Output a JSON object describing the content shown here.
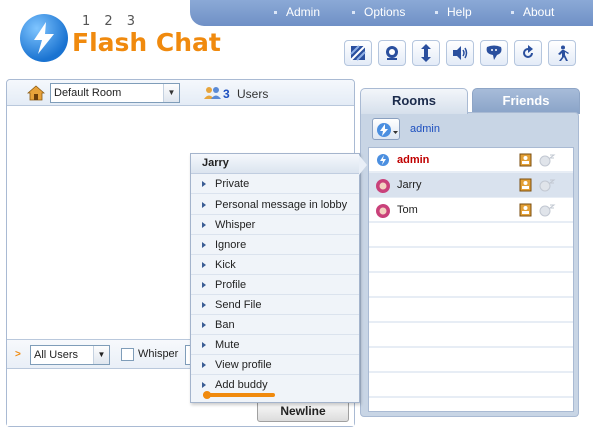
{
  "logo": {
    "number": "1 2 3",
    "title": "Flash Chat"
  },
  "nav": [
    {
      "label": "Admin"
    },
    {
      "label": "Options"
    },
    {
      "label": "Help"
    },
    {
      "label": "About"
    }
  ],
  "toolbar": {
    "icons": [
      "skin-icon",
      "avatar-icon",
      "font-size-icon",
      "sound-icon",
      "smileys-icon",
      "refresh-icon",
      "logout-icon"
    ]
  },
  "room": {
    "selected": "Default Room"
  },
  "users": {
    "count": "3",
    "label": "Users"
  },
  "input": {
    "recipient": "All Users",
    "whisper_label": "Whisper",
    "newline_label": "Newline"
  },
  "tabs": {
    "rooms": "Rooms",
    "friends": "Friends"
  },
  "me": {
    "name": "admin"
  },
  "user_list": [
    {
      "name": "admin",
      "role": "admin"
    },
    {
      "name": "Jarry",
      "role": "user"
    },
    {
      "name": "Tom",
      "role": "user"
    }
  ],
  "context_menu": {
    "title": "Jarry",
    "items": [
      "Private",
      "Personal message in lobby",
      "Whisper",
      "Ignore",
      "Kick",
      "Profile",
      "Send File",
      "Ban",
      "Mute",
      "View profile",
      "Add buddy"
    ]
  },
  "colors": {
    "accent": "#f08a0e",
    "nav_bg": "#7b9bcd",
    "admin_name": "#c00000",
    "link": "#1d4fbf"
  }
}
